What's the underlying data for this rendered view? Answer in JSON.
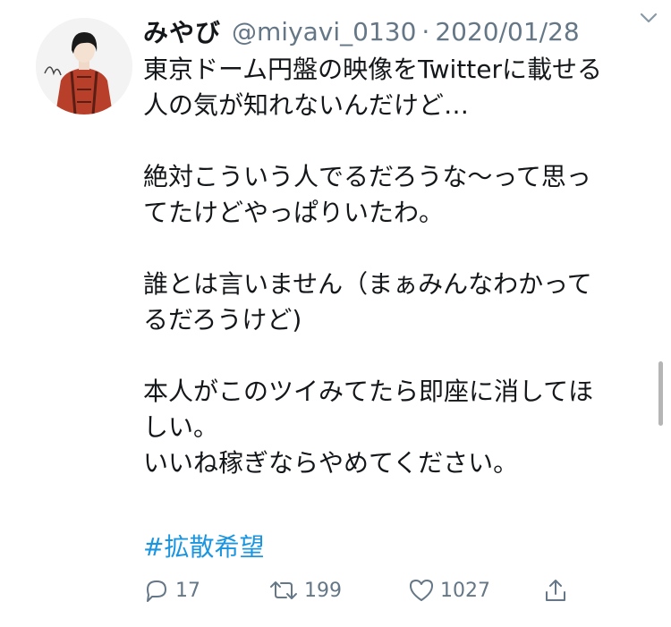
{
  "tweet": {
    "display_name": "みやび",
    "handle": "@miyavi_0130",
    "separator": "·",
    "date": "2020/01/28",
    "body": "東京ドーム円盤の映像をTwitterに載せる\n人の気が知れないんだけど…\n\n絶対こういう人でるだろうな〜って思っ\nてたけどやっぱりいたわ。\n\n誰とは言いません（まぁみんなわかって\nるだろうけど)\n\n本人がこのツイみてたら即座に消してほ\nしい。\nいいね稼ぎならやめてください。",
    "hashtag": "#拡散希望"
  },
  "actions": {
    "reply_count": "17",
    "retweet_count": "199",
    "like_count": "1027"
  },
  "icons": {
    "reply": "reply-icon",
    "retweet": "retweet-icon",
    "like": "heart-icon",
    "share": "share-icon",
    "more": "chevron-down-icon"
  },
  "colors": {
    "link": "#1b95e0",
    "muted": "#657786",
    "text": "#14171a"
  }
}
